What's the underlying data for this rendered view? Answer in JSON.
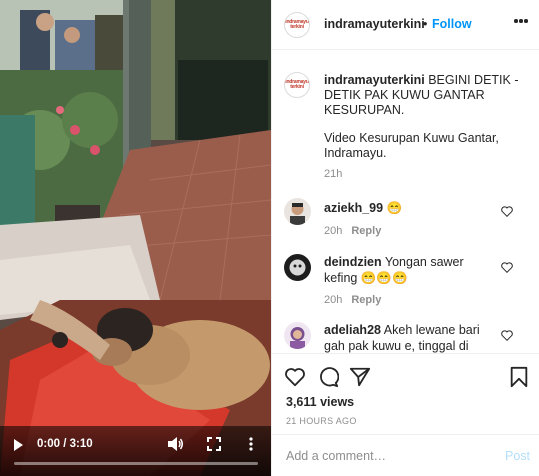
{
  "video": {
    "time_display": "0:00 / 3:10",
    "progress_fraction": 0.0,
    "icons": [
      "play-icon",
      "volume-icon",
      "fullscreen-icon",
      "more-vert-icon"
    ]
  },
  "header": {
    "username": "indramayuterkini",
    "separator": "•",
    "follow_label": "Follow",
    "avatar_text": "indramayu terkini"
  },
  "caption": {
    "username": "indramayuterkini",
    "text": "BEGINI DETIK - DETIK PAK KUWU GANTAR KESURUPAN.",
    "subtext": "Video Kesurupan Kuwu Gantar, Indramayu.",
    "time": "21h"
  },
  "comments": [
    {
      "username": "aziekh_99",
      "text": "😁",
      "time": "20h",
      "reply_label": "Reply"
    },
    {
      "username": "deindzien",
      "text": "Yongan sawer kefing 😁😁😁",
      "time": "20h",
      "reply_label": "Reply"
    },
    {
      "username": "adeliah28",
      "text": "Akeh lewane bari gah pak kuwu e, tinggal di tonton",
      "time": "",
      "reply_label": ""
    }
  ],
  "actions": {
    "icons": [
      "heart-icon",
      "comment-icon",
      "share-icon",
      "bookmark-icon"
    ],
    "views": "3,611 views",
    "posted": "21 HOURS AGO"
  },
  "add_comment": {
    "placeholder": "Add a comment…",
    "post_label": "Post"
  },
  "colors": {
    "link_blue": "#0095f6",
    "post_disabled": "#b2dffc",
    "muted_text": "#8e8e8e",
    "border": "#efefef"
  }
}
